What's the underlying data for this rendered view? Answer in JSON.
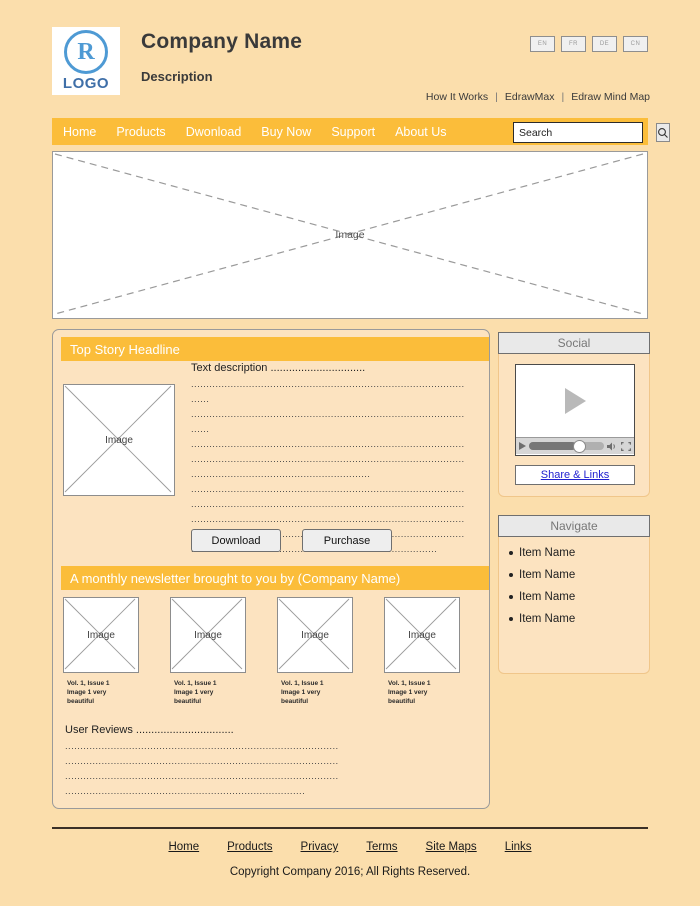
{
  "theme": {
    "page_bg": "#fbdeac",
    "accent": "#fbbd3a",
    "card_bg": "#fce3c0",
    "logo_blue": "#4e9ad4",
    "link_blue": "#2020d0"
  },
  "header": {
    "logo": {
      "mark": "R",
      "text": "LOGO"
    },
    "company_name": "Company Name",
    "description": "Description",
    "languages": [
      {
        "label": "EN"
      },
      {
        "label": "FR"
      },
      {
        "label": "DE"
      },
      {
        "label": "CN"
      }
    ],
    "top_links": [
      {
        "label": "How It Works"
      },
      {
        "label": "EdrawMax"
      },
      {
        "label": "Edraw Mind Map"
      }
    ],
    "separator": "|"
  },
  "nav": {
    "items": [
      {
        "label": "Home"
      },
      {
        "label": "Products"
      },
      {
        "label": "Dwonload"
      },
      {
        "label": "Buy Now"
      },
      {
        "label": "Support"
      },
      {
        "label": "About Us"
      }
    ],
    "search": {
      "value": "Search",
      "placeholder": "Search",
      "icon": "search-icon"
    }
  },
  "hero": {
    "label": "Image"
  },
  "main": {
    "top_story": {
      "headline": "Top Story Headline",
      "image_label": "Image",
      "text_intro": "Text description ...............................",
      "text_lines": [
        "..........................................................................................",
        "......",
        "..........................................................................................",
        "......",
        "..........................................................................................",
        "..........................................................................................",
        "...........................................................",
        "..........................................................................................",
        "..........................................................................................",
        "..........................................................................................",
        "..........................................................................................",
        "................................................................................."
      ],
      "buttons": [
        {
          "label": "Download"
        },
        {
          "label": "Purchase"
        }
      ]
    },
    "newsletter": {
      "headline": "A monthly newsletter brought to you by (Company Name)",
      "thumbs": [
        {
          "image_label": "Image",
          "caption": "Vol. 1, Issue 1\nImage 1 very\nbeautiful"
        },
        {
          "image_label": "Image",
          "caption": "Vol. 1, Issue 1\nImage 1 very\nbeautiful"
        },
        {
          "image_label": "Image",
          "caption": "Vol. 1, Issue 1\nImage 1 very\nbeautiful"
        },
        {
          "image_label": "Image",
          "caption": "Vol. 1, Issue 1\nImage 1 very\nbeautiful"
        }
      ]
    },
    "reviews": {
      "heading": "User Reviews ................................",
      "lines": [
        "..........................................................................................",
        "..........................................................................................",
        "..........................................................................................",
        "..............................................................................."
      ]
    }
  },
  "sidebar": {
    "social": {
      "title": "Social",
      "player": {
        "play_icon": "play-icon",
        "controls_play_icon": "play-small-icon",
        "volume_icon": "volume-icon",
        "fullscreen_icon": "fullscreen-icon"
      },
      "share_label": "Share & Links"
    },
    "navigate": {
      "title": "Navigate",
      "items": [
        {
          "label": "Item Name"
        },
        {
          "label": "Item Name"
        },
        {
          "label": "Item Name"
        },
        {
          "label": "Item Name"
        }
      ]
    }
  },
  "footer": {
    "links": [
      {
        "label": "Home"
      },
      {
        "label": "Products"
      },
      {
        "label": "Privacy"
      },
      {
        "label": "Terms"
      },
      {
        "label": "Site Maps"
      },
      {
        "label": "Links"
      }
    ],
    "copyright": "Copyright Company 2016; All Rights Reserved."
  }
}
